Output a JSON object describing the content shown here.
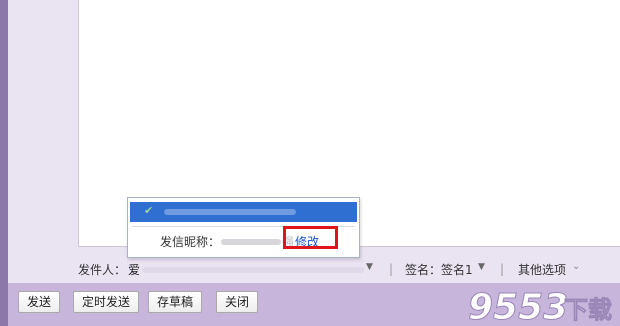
{
  "sender": {
    "label": "发件人：",
    "value_prefix": "爱",
    "signature_label": "签名：",
    "signature_value": "签名1",
    "separator": "|",
    "other_options": "其他选项"
  },
  "popup": {
    "nickname_label": "发信昵称：",
    "nickname_tail": "强",
    "edit_label": "修改"
  },
  "toolbar": {
    "send": "发送",
    "scheduled_send": "定时发送",
    "save_draft": "存草稿",
    "close": "关闭"
  },
  "watermark": {
    "digits": "9553",
    "suffix": "下载"
  },
  "icons": {
    "dropdown": "triangle-down",
    "more": "double-chevron-down",
    "check": "check"
  }
}
